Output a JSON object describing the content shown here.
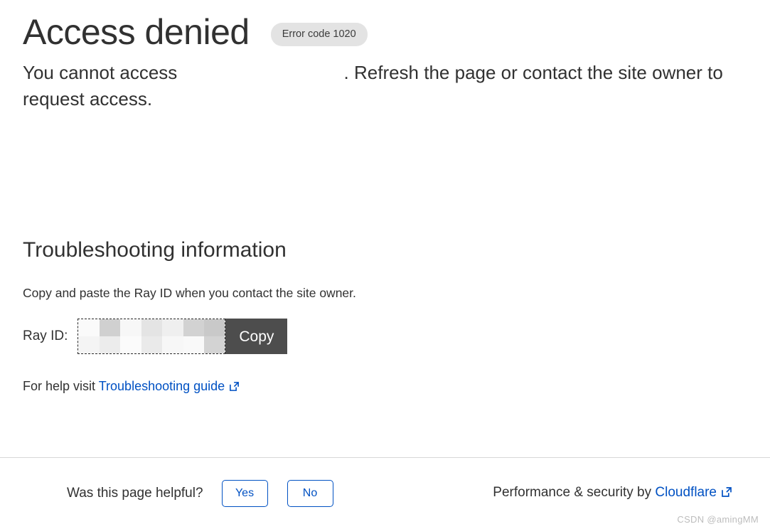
{
  "header": {
    "title": "Access denied",
    "error_badge": "Error code 1020"
  },
  "lead": {
    "text_before": "You cannot access ",
    "redacted_value": "",
    "text_after": ". Refresh the page or contact the site owner to request access."
  },
  "troubleshooting": {
    "section_title": "Troubleshooting information",
    "description": "Copy and paste the Ray ID when you contact the site owner.",
    "ray_id_label": "Ray ID:",
    "ray_id_value": "",
    "copy_label": "Copy",
    "help_prefix": "For help visit ",
    "help_link_label": "Troubleshooting guide"
  },
  "footer": {
    "question": "Was this page helpful?",
    "yes_label": "Yes",
    "no_label": "No",
    "attribution_prefix": "Performance & security by ",
    "attribution_link_label": "Cloudflare"
  },
  "watermark": {
    "text": "CSDN @amingMM"
  },
  "colors": {
    "link": "#0051c3",
    "text": "#313131",
    "badge_bg": "#e3e3e3",
    "copy_button_bg": "#4d4d4d",
    "divider": "#d7d7d7",
    "watermark": "#bdbdbd"
  },
  "redaction": {
    "lead_blocks": [
      "#cfcfcf",
      "#e6e5e5",
      "#c6c6c4",
      "#e3e3e3",
      "#e0e0e0",
      "#d6d6d6",
      "#c5c5c3",
      "#ededed"
    ],
    "ray_id_blocks": [
      "#fafafa",
      "#d0d0d0",
      "#f7f7f7",
      "#e4e4e4",
      "#efefef",
      "#d2d2d2",
      "#c9c9c9",
      "#f4f4f4",
      "#ececec",
      "#fbfbfb",
      "#eaeaea",
      "#f7f7f7",
      "#f9f9f9",
      "#d3d3d3"
    ]
  }
}
